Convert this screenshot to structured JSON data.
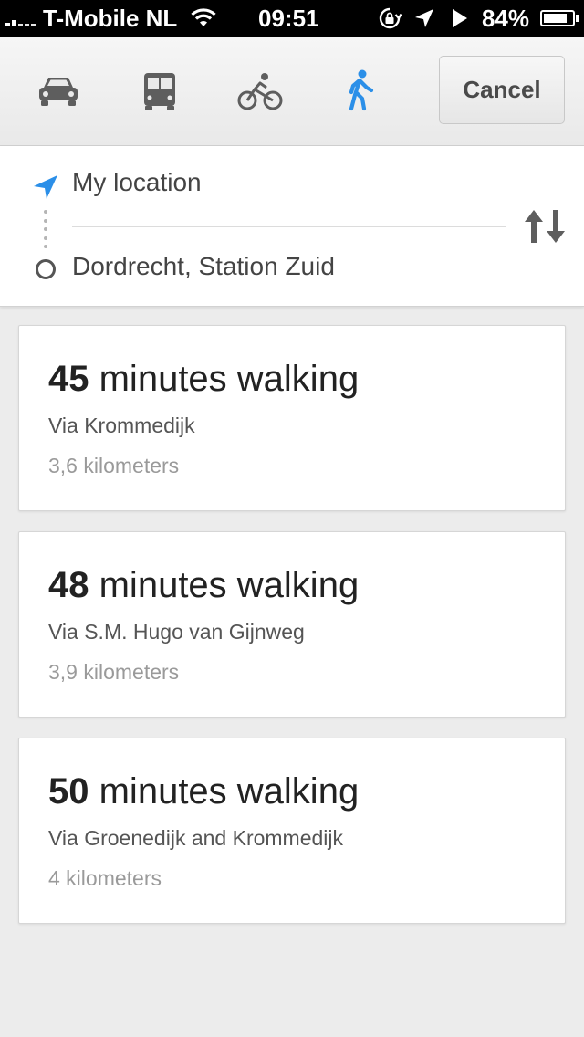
{
  "status_bar": {
    "carrier": "T-Mobile NL",
    "time": "09:51",
    "battery_percent": "84%",
    "battery_level": 0.84,
    "icons": [
      "signal-icon",
      "wifi-icon",
      "rotation-lock-icon",
      "location-arrow-icon",
      "play-icon",
      "battery-icon"
    ]
  },
  "toolbar": {
    "modes": [
      {
        "name": "driving",
        "icon": "car-icon",
        "selected": false
      },
      {
        "name": "transit",
        "icon": "bus-icon",
        "selected": false
      },
      {
        "name": "cycling",
        "icon": "bicycle-icon",
        "selected": false
      },
      {
        "name": "walking",
        "icon": "walking-icon",
        "selected": true
      }
    ],
    "cancel_label": "Cancel"
  },
  "route": {
    "from": "My location",
    "to": "Dordrecht, Station Zuid",
    "icons": [
      "navigation-arrow-icon",
      "destination-circle-icon",
      "swap-icon"
    ]
  },
  "results": [
    {
      "minutes": "45",
      "suffix": " minutes walking",
      "via": "Via Krommedijk",
      "distance": "3,6 kilometers"
    },
    {
      "minutes": "48",
      "suffix": " minutes walking",
      "via": "Via S.M. Hugo van Gijnweg",
      "distance": "3,9 kilometers"
    },
    {
      "minutes": "50",
      "suffix": " minutes walking",
      "via": "Via Groenedijk and Krommedijk",
      "distance": "4 kilometers"
    }
  ],
  "colors": {
    "accent_blue": "#2b8fe8",
    "icon_gray": "#5e5e5e",
    "status_bar_bg": "#000000",
    "page_bg": "#ececec"
  }
}
